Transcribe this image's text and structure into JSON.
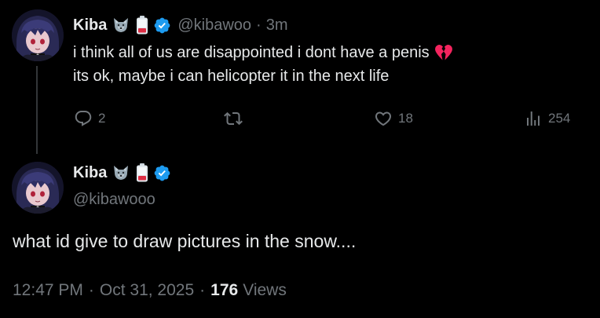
{
  "tweet_reply": {
    "display_name": "Kiba",
    "handle": "@kibawoo",
    "separator": "·",
    "time": "3m",
    "text_line_1": "i think all of us are disappointed i dont have a penis",
    "text_line_2": "its ok, maybe i can helicopter it in the next life",
    "reply_count": "2",
    "retweet_count": "",
    "like_count": "18",
    "view_count": "254",
    "icons": {
      "emoji_1": "wolf-face-icon",
      "emoji_2": "low-battery-icon",
      "verified": "verified-badge-icon",
      "text_emoji": "broken-heart-icon"
    }
  },
  "tweet_main": {
    "display_name": "Kiba",
    "handle": "@kibawooo",
    "text": "what id give to draw pictures in the snow....",
    "timestamp_time": "12:47 PM",
    "separator": "·",
    "timestamp_date": "Oct 31, 2025",
    "views_count": "176",
    "views_label": "Views"
  },
  "colors": {
    "background": "#000000",
    "primary_text": "#e7e9ea",
    "secondary_text": "#71767b",
    "verified_blue": "#1d9bf0",
    "thread_line": "#333639",
    "broken_heart": "#f4245e"
  }
}
